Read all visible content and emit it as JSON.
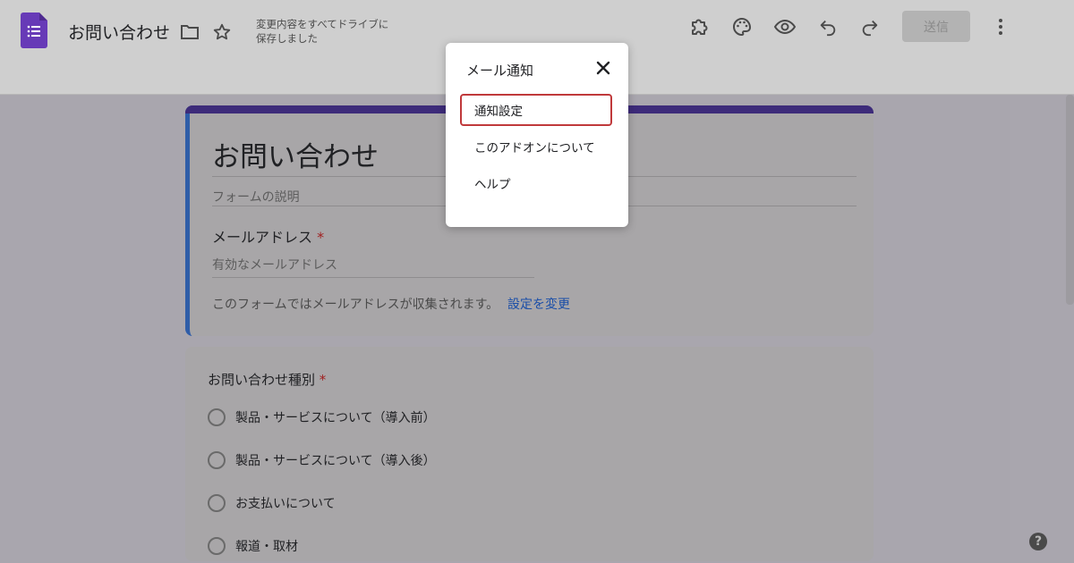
{
  "header": {
    "doc_title": "お問い合わせ",
    "save_status_line1": "変更内容をすべてドライブに",
    "save_status_line2": "保存しました",
    "send_label": "送信",
    "icons": [
      "forms-logo-icon",
      "folder-icon",
      "star-icon",
      "addon-puzzle-icon",
      "palette-icon",
      "eye-preview-icon",
      "undo-icon",
      "redo-icon",
      "more-vert-icon"
    ]
  },
  "form": {
    "title": "お問い合わせ",
    "description_placeholder": "フォームの説明",
    "email_question": "メールアドレス",
    "required_mark": "*",
    "email_placeholder": "有効なメールアドレス",
    "collect_note": "このフォームではメールアドレスが収集されます。",
    "change_settings_link": "設定を変更"
  },
  "question2": {
    "label": "お問い合わせ種別",
    "required_mark": "*",
    "options": [
      "製品・サービスについて（導入前）",
      "製品・サービスについて（導入後）",
      "お支払いについて",
      "報道・取材"
    ]
  },
  "dialog": {
    "title": "メール通知",
    "items": [
      "通知設定",
      "このアドオンについて",
      "ヘルプ"
    ],
    "selected_index": 0
  },
  "help_label": "?",
  "colors": {
    "forms_purple": "#673ab7",
    "link_blue": "#1a4ea8",
    "required_red": "#a02020",
    "highlight_red": "#c0393b"
  }
}
